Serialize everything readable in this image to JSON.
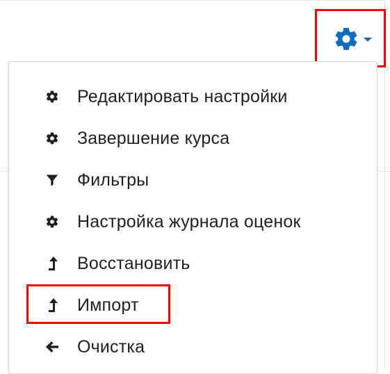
{
  "settings_menu": {
    "trigger": {
      "icon": "gear-icon",
      "caret": "caret-down-icon",
      "color": "#0f6cbf"
    },
    "highlight_color": "#ff0000",
    "items": [
      {
        "label": "Редактировать настройки",
        "icon": "gear-icon"
      },
      {
        "label": "Завершение курса",
        "icon": "gear-icon"
      },
      {
        "label": "Фильтры",
        "icon": "filter-icon"
      },
      {
        "label": "Настройка журнала оценок",
        "icon": "gear-icon"
      },
      {
        "label": "Восстановить",
        "icon": "level-up-icon"
      },
      {
        "label": "Импорт",
        "icon": "level-up-icon"
      },
      {
        "label": "Очистка",
        "icon": "arrow-left-icon"
      }
    ]
  }
}
